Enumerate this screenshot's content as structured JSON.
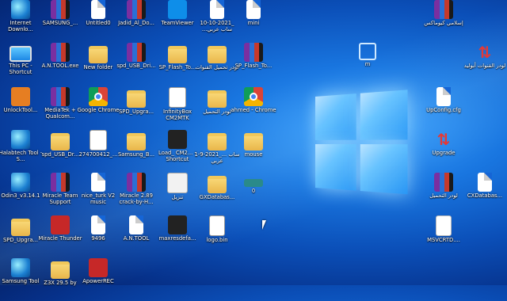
{
  "desktop": {
    "icons": [
      {
        "label": "Internet Downlo...",
        "icon": "idm-icon",
        "type": "globe"
      },
      {
        "label": "SAMSUNG_...",
        "icon": "rar-archive-icon",
        "type": "rar"
      },
      {
        "label": "Untitled0",
        "icon": "file-icon",
        "type": "file"
      },
      {
        "label": "Jadid_Al_Do...",
        "icon": "rar-archive-icon",
        "type": "rar"
      },
      {
        "label": "TeamViewer",
        "icon": "teamviewer-icon",
        "type": "tv"
      },
      {
        "label": "10-10-2021_ ...ساب عربي",
        "icon": "file-icon",
        "type": "file"
      },
      {
        "label": "mini",
        "icon": "file-icon",
        "type": "file"
      },
      {
        "label": "إسلامي كيوماكس",
        "icon": "rar-archive-icon",
        "type": "rar"
      },
      {
        "label": "This PC - Shortcut",
        "icon": "this-pc-icon",
        "type": "pc"
      },
      {
        "label": "A.N.TOOL.exe",
        "icon": "rar-archive-icon",
        "type": "rar"
      },
      {
        "label": "New folder",
        "icon": "folder-icon",
        "type": "folder"
      },
      {
        "label": "spd_USB_Dri...",
        "icon": "rar-archive-icon",
        "type": "rar"
      },
      {
        "label": "SP_Flash_To...",
        "icon": "folder-icon",
        "type": "folder"
      },
      {
        "label": "لودر تحميل القنوات",
        "icon": "folder-icon",
        "type": "folder"
      },
      {
        "label": "SP_Flash_To...",
        "icon": "rar-archive-icon",
        "type": "rar"
      },
      {
        "label": "m",
        "icon": "network-icon",
        "type": "network"
      },
      {
        "label": "لودر القنوات أبوليد",
        "icon": "arrows-icon",
        "type": "arrows"
      },
      {
        "label": "UnlockTool...",
        "icon": "unlocktool-icon",
        "type": "orange"
      },
      {
        "label": "MediaTek + Qualcom...",
        "icon": "rar-archive-icon",
        "type": "rar"
      },
      {
        "label": "Google Chrome",
        "icon": "chrome-icon",
        "type": "chrome"
      },
      {
        "label": "SPD_Upgra...",
        "icon": "folder-icon",
        "type": "folder"
      },
      {
        "label": "InfinityBox CM2MTK",
        "icon": "infinity-icon",
        "type": "exe"
      },
      {
        "label": "لودر التحميل",
        "icon": "folder-icon",
        "type": "folder"
      },
      {
        "label": "ahmed - Chrome",
        "icon": "chrome-icon",
        "type": "chrome"
      },
      {
        "label": "UpConfig.cfg",
        "icon": "file-icon",
        "type": "file"
      },
      {
        "label": "Halabtech Tool - S...",
        "icon": "halabtech-icon",
        "type": "globe"
      },
      {
        "label": "spd_USB_Dr...",
        "icon": "folder-icon",
        "type": "folder"
      },
      {
        "label": "274700412_...",
        "icon": "image-file-icon",
        "type": "exe"
      },
      {
        "label": "Samsung_B...",
        "icon": "folder-icon",
        "type": "folder"
      },
      {
        "label": "Load_ CM2... - Shortcut",
        "icon": "r-shortcut-icon",
        "type": "dark"
      },
      {
        "label": "1-9-2021_... ساب عربي",
        "icon": "folder-icon",
        "type": "folder"
      },
      {
        "label": "mouse",
        "icon": "folder-icon",
        "type": "folder"
      },
      {
        "label": "Upgrade",
        "icon": "arrows-icon",
        "type": "arrows"
      },
      {
        "label": "Odin3_v3.14.1",
        "icon": "odin-icon",
        "type": "globe"
      },
      {
        "label": "Miracle Team Support",
        "icon": "miracle-icon",
        "type": "rar"
      },
      {
        "label": "nice_turk V2 music",
        "icon": "file-icon",
        "type": "file"
      },
      {
        "label": "Miracle 2.89 crack-by-H...",
        "icon": "rar-archive-icon",
        "type": "rar"
      },
      {
        "label": "تنزيل",
        "icon": "file-icon",
        "type": "link"
      },
      {
        "label": "GXDatabas...",
        "icon": "folder-icon",
        "type": "folder"
      },
      {
        "label": "0",
        "icon": "bar-icon",
        "type": "bar"
      },
      {
        "label": "لودر التحميل",
        "icon": "rar-archive-icon",
        "type": "rar"
      },
      {
        "label": "CXDatabas...",
        "icon": "file-icon",
        "type": "file"
      },
      {
        "label": "SPD_Upgra...",
        "icon": "folder-icon",
        "type": "folder"
      },
      {
        "label": "Miracle Thunder",
        "icon": "miracle-thunder-icon",
        "type": "red"
      },
      {
        "label": "9496",
        "icon": "file-icon",
        "type": "file"
      },
      {
        "label": "A.N.TOOL",
        "icon": "file-icon",
        "type": "file"
      },
      {
        "label": "maxresdefa...",
        "icon": "image-icon",
        "type": "dark"
      },
      {
        "label": "logo.bin",
        "icon": "file-icon",
        "type": "bin"
      },
      {
        "label": "MSVCRTD....",
        "icon": "certificate-icon",
        "type": "cert"
      },
      {
        "label": "Samsung Tool",
        "icon": "samsung-tool-icon",
        "type": "globe"
      },
      {
        "label": "Z3X 29.5 by",
        "icon": "folder-icon",
        "type": "folder"
      },
      {
        "label": "ApowerREC",
        "icon": "apowerrec-icon",
        "type": "red"
      }
    ]
  }
}
